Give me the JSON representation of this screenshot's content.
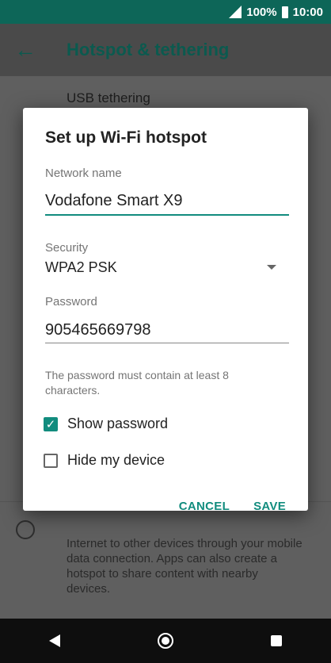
{
  "status": {
    "battery": "100%",
    "time": "10:00"
  },
  "appbar": {
    "title": "Hotspot & tethering"
  },
  "background": {
    "usb_label": "USB tethering",
    "desc": "Internet to other devices through your mobile data connection. Apps can also create a hotspot to share content with nearby devices."
  },
  "dialog": {
    "title": "Set up Wi-Fi hotspot",
    "network_label": "Network name",
    "network_value": "Vodafone Smart X9",
    "security_label": "Security",
    "security_value": "WPA2 PSK",
    "password_label": "Password",
    "password_value": "905465669798",
    "hint": "The password must contain at least 8 characters.",
    "show_password": "Show password",
    "show_password_checked": true,
    "hide_device": "Hide my device",
    "hide_device_checked": false,
    "cancel": "CANCEL",
    "save": "SAVE"
  },
  "colors": {
    "accent": "#128c7e",
    "statusbar": "#0d6658"
  }
}
